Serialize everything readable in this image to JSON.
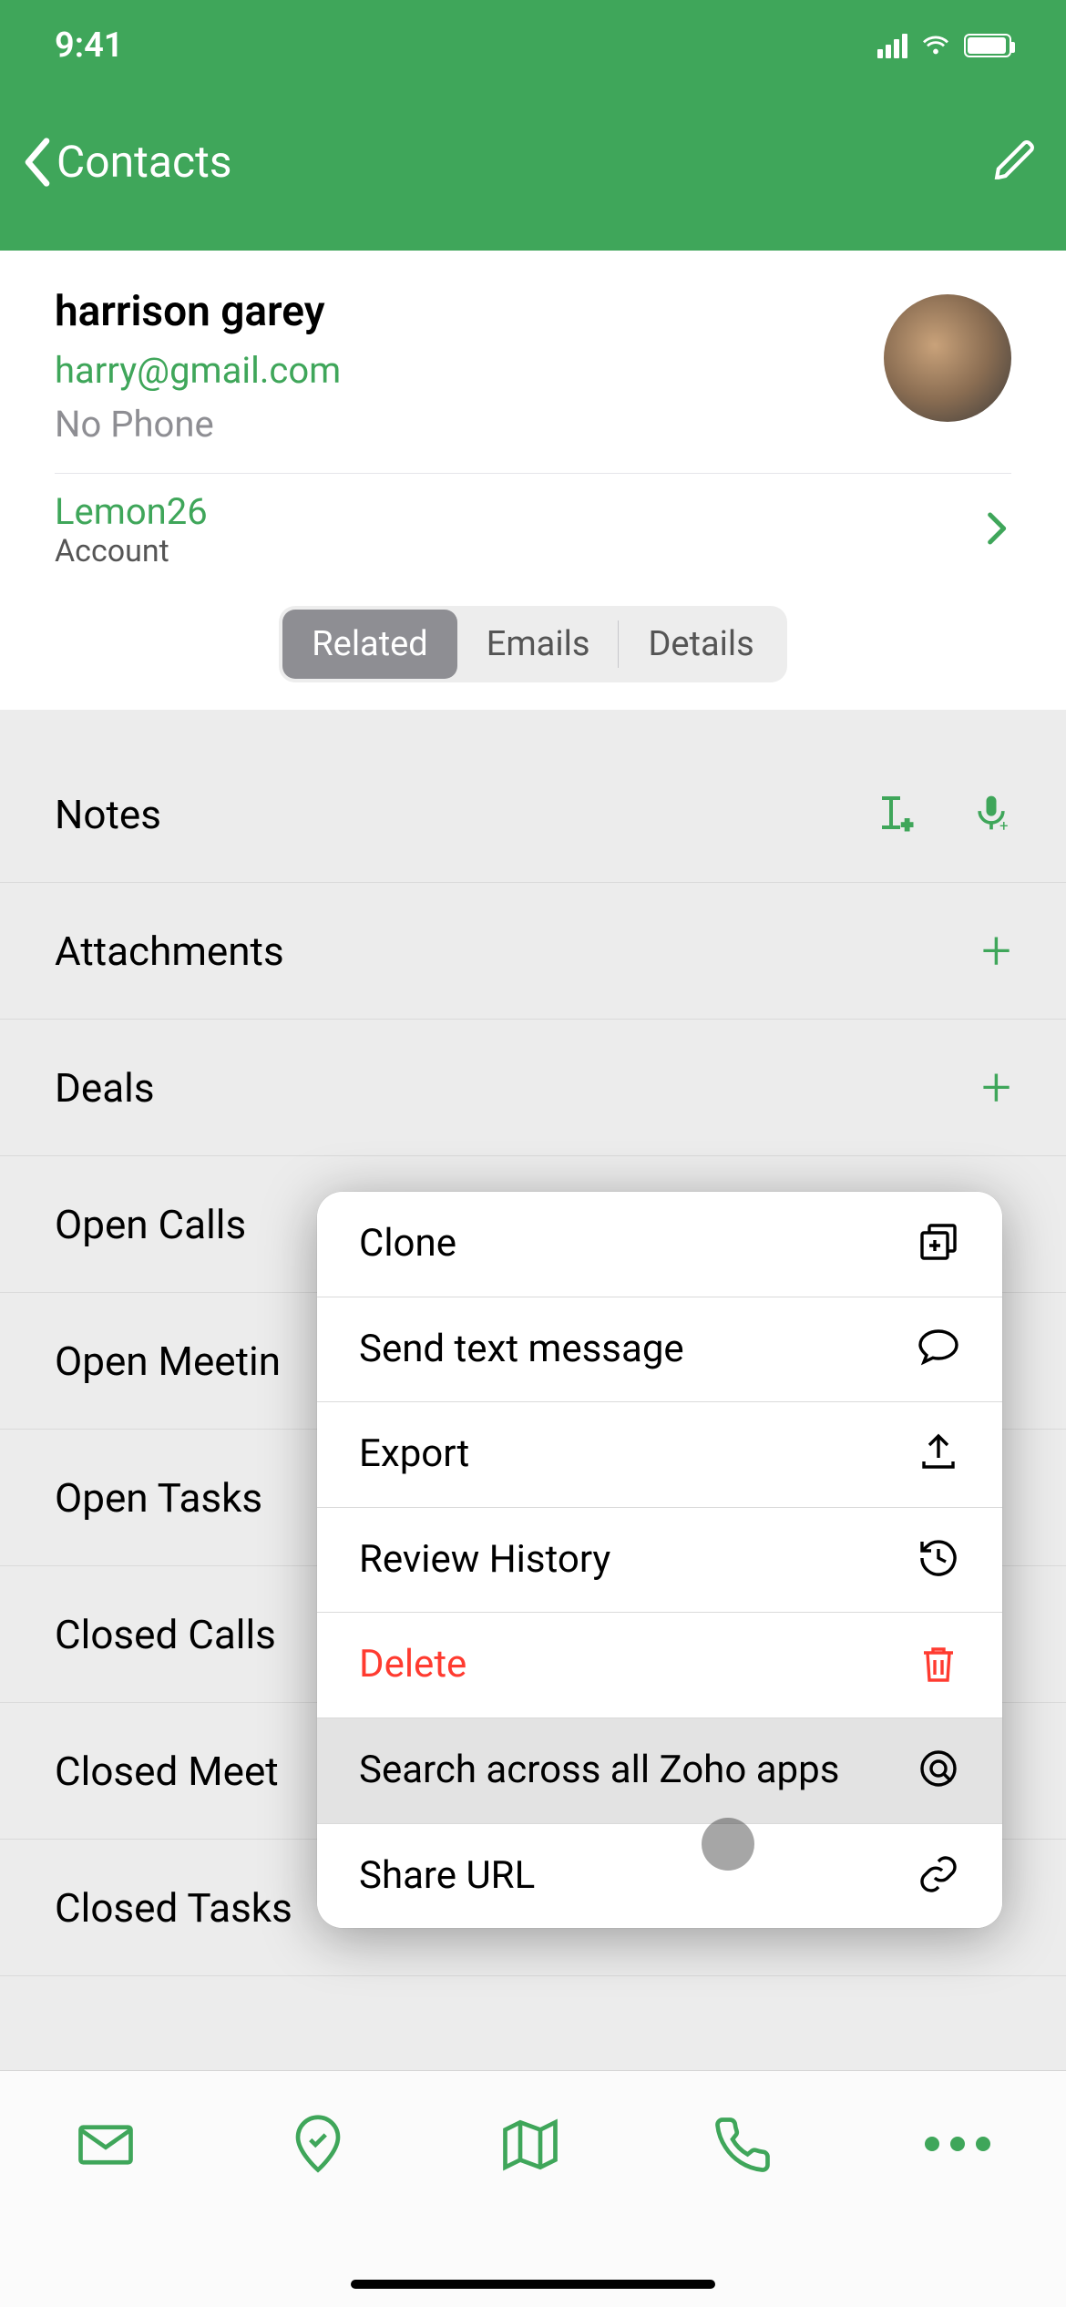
{
  "status": {
    "time": "9:41"
  },
  "nav": {
    "title": "Contacts"
  },
  "contact": {
    "name": "harrison garey",
    "email": "harry@gmail.com",
    "phone": "No Phone"
  },
  "account": {
    "name": "Lemon26",
    "label": "Account"
  },
  "tabs": {
    "related": "Related",
    "emails": "Emails",
    "details": "Details"
  },
  "list": {
    "notes": "Notes",
    "attachments": "Attachments",
    "deals": "Deals",
    "open_calls": "Open Calls",
    "open_meetings": "Open Meetin",
    "open_tasks": "Open Tasks",
    "closed_calls": "Closed Calls",
    "closed_meetings": "Closed Meet",
    "closed_tasks": "Closed Tasks"
  },
  "popup": {
    "clone": "Clone",
    "send_text": "Send text message",
    "export": "Export",
    "review_history": "Review History",
    "delete": "Delete",
    "search_zoho": "Search across all Zoho apps",
    "share_url": "Share URL"
  }
}
